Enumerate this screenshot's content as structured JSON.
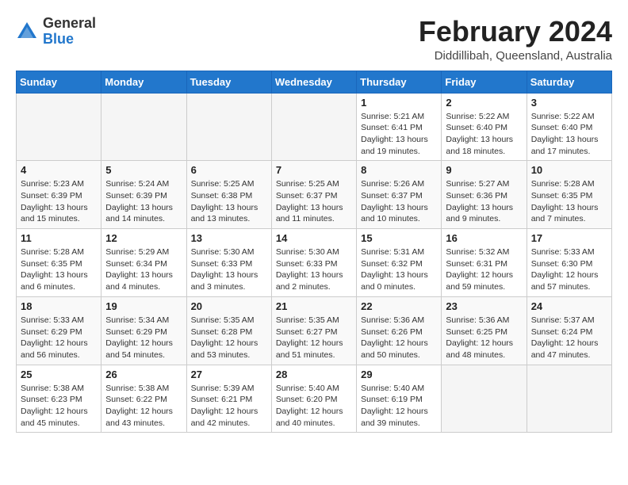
{
  "header": {
    "logo_general": "General",
    "logo_blue": "Blue",
    "month_year": "February 2024",
    "location": "Diddillibah, Queensland, Australia"
  },
  "weekdays": [
    "Sunday",
    "Monday",
    "Tuesday",
    "Wednesday",
    "Thursday",
    "Friday",
    "Saturday"
  ],
  "weeks": [
    [
      {
        "day": "",
        "info": ""
      },
      {
        "day": "",
        "info": ""
      },
      {
        "day": "",
        "info": ""
      },
      {
        "day": "",
        "info": ""
      },
      {
        "day": "1",
        "info": "Sunrise: 5:21 AM\nSunset: 6:41 PM\nDaylight: 13 hours\nand 19 minutes."
      },
      {
        "day": "2",
        "info": "Sunrise: 5:22 AM\nSunset: 6:40 PM\nDaylight: 13 hours\nand 18 minutes."
      },
      {
        "day": "3",
        "info": "Sunrise: 5:22 AM\nSunset: 6:40 PM\nDaylight: 13 hours\nand 17 minutes."
      }
    ],
    [
      {
        "day": "4",
        "info": "Sunrise: 5:23 AM\nSunset: 6:39 PM\nDaylight: 13 hours\nand 15 minutes."
      },
      {
        "day": "5",
        "info": "Sunrise: 5:24 AM\nSunset: 6:39 PM\nDaylight: 13 hours\nand 14 minutes."
      },
      {
        "day": "6",
        "info": "Sunrise: 5:25 AM\nSunset: 6:38 PM\nDaylight: 13 hours\nand 13 minutes."
      },
      {
        "day": "7",
        "info": "Sunrise: 5:25 AM\nSunset: 6:37 PM\nDaylight: 13 hours\nand 11 minutes."
      },
      {
        "day": "8",
        "info": "Sunrise: 5:26 AM\nSunset: 6:37 PM\nDaylight: 13 hours\nand 10 minutes."
      },
      {
        "day": "9",
        "info": "Sunrise: 5:27 AM\nSunset: 6:36 PM\nDaylight: 13 hours\nand 9 minutes."
      },
      {
        "day": "10",
        "info": "Sunrise: 5:28 AM\nSunset: 6:35 PM\nDaylight: 13 hours\nand 7 minutes."
      }
    ],
    [
      {
        "day": "11",
        "info": "Sunrise: 5:28 AM\nSunset: 6:35 PM\nDaylight: 13 hours\nand 6 minutes."
      },
      {
        "day": "12",
        "info": "Sunrise: 5:29 AM\nSunset: 6:34 PM\nDaylight: 13 hours\nand 4 minutes."
      },
      {
        "day": "13",
        "info": "Sunrise: 5:30 AM\nSunset: 6:33 PM\nDaylight: 13 hours\nand 3 minutes."
      },
      {
        "day": "14",
        "info": "Sunrise: 5:30 AM\nSunset: 6:33 PM\nDaylight: 13 hours\nand 2 minutes."
      },
      {
        "day": "15",
        "info": "Sunrise: 5:31 AM\nSunset: 6:32 PM\nDaylight: 13 hours\nand 0 minutes."
      },
      {
        "day": "16",
        "info": "Sunrise: 5:32 AM\nSunset: 6:31 PM\nDaylight: 12 hours\nand 59 minutes."
      },
      {
        "day": "17",
        "info": "Sunrise: 5:33 AM\nSunset: 6:30 PM\nDaylight: 12 hours\nand 57 minutes."
      }
    ],
    [
      {
        "day": "18",
        "info": "Sunrise: 5:33 AM\nSunset: 6:29 PM\nDaylight: 12 hours\nand 56 minutes."
      },
      {
        "day": "19",
        "info": "Sunrise: 5:34 AM\nSunset: 6:29 PM\nDaylight: 12 hours\nand 54 minutes."
      },
      {
        "day": "20",
        "info": "Sunrise: 5:35 AM\nSunset: 6:28 PM\nDaylight: 12 hours\nand 53 minutes."
      },
      {
        "day": "21",
        "info": "Sunrise: 5:35 AM\nSunset: 6:27 PM\nDaylight: 12 hours\nand 51 minutes."
      },
      {
        "day": "22",
        "info": "Sunrise: 5:36 AM\nSunset: 6:26 PM\nDaylight: 12 hours\nand 50 minutes."
      },
      {
        "day": "23",
        "info": "Sunrise: 5:36 AM\nSunset: 6:25 PM\nDaylight: 12 hours\nand 48 minutes."
      },
      {
        "day": "24",
        "info": "Sunrise: 5:37 AM\nSunset: 6:24 PM\nDaylight: 12 hours\nand 47 minutes."
      }
    ],
    [
      {
        "day": "25",
        "info": "Sunrise: 5:38 AM\nSunset: 6:23 PM\nDaylight: 12 hours\nand 45 minutes."
      },
      {
        "day": "26",
        "info": "Sunrise: 5:38 AM\nSunset: 6:22 PM\nDaylight: 12 hours\nand 43 minutes."
      },
      {
        "day": "27",
        "info": "Sunrise: 5:39 AM\nSunset: 6:21 PM\nDaylight: 12 hours\nand 42 minutes."
      },
      {
        "day": "28",
        "info": "Sunrise: 5:40 AM\nSunset: 6:20 PM\nDaylight: 12 hours\nand 40 minutes."
      },
      {
        "day": "29",
        "info": "Sunrise: 5:40 AM\nSunset: 6:19 PM\nDaylight: 12 hours\nand 39 minutes."
      },
      {
        "day": "",
        "info": ""
      },
      {
        "day": "",
        "info": ""
      }
    ]
  ]
}
